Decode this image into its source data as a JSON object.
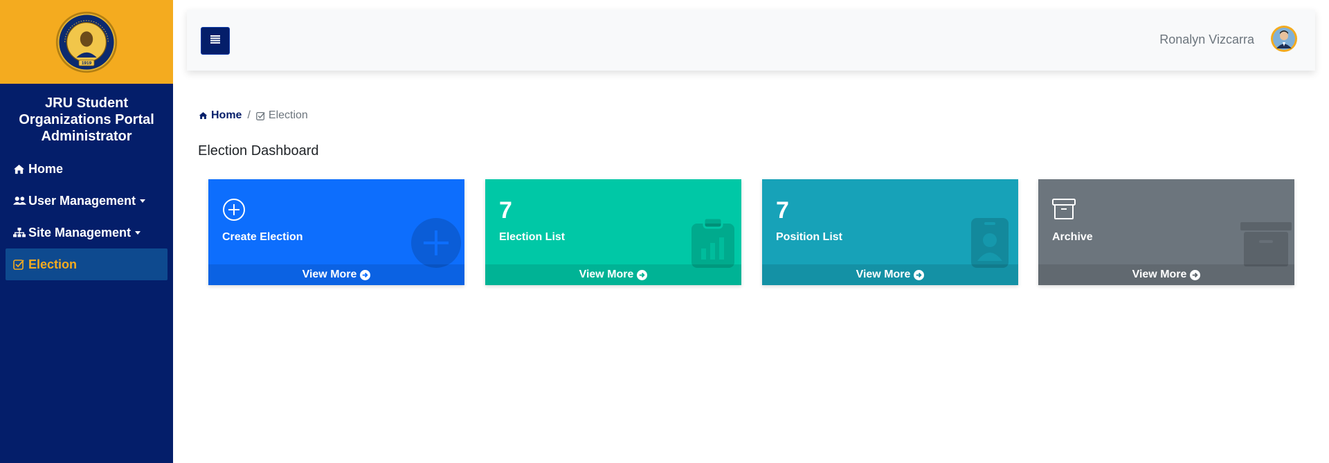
{
  "app": {
    "title": "JRU Student Organizations Portal Administrator"
  },
  "colors": {
    "sidebar": "#041e6a",
    "accent": "#f4ab1f",
    "active_item": "#0e4a8f"
  },
  "logo": {
    "text": "JOSE RIZAL UNIVERSITY",
    "year": "1919"
  },
  "sidebar": {
    "items": [
      {
        "label": "Home",
        "icon": "home-icon"
      },
      {
        "label": "User Management",
        "icon": "users-icon",
        "dropdown": true
      },
      {
        "label": "Site Management",
        "icon": "sitemap-icon",
        "dropdown": true
      },
      {
        "label": "Election",
        "icon": "check-square-icon",
        "active": true
      }
    ]
  },
  "header": {
    "user_name": "Ronalyn Vizcarra"
  },
  "breadcrumb": {
    "home": "Home",
    "current": "Election"
  },
  "page": {
    "title": "Election Dashboard"
  },
  "cards": [
    {
      "label": "Create Election",
      "value": "",
      "icon": "plus-circle-icon",
      "color": "#0d6efd",
      "footer": "View More"
    },
    {
      "label": "Election List",
      "value": "7",
      "icon": "clipboard-chart-icon",
      "color": "#00c8a6",
      "footer": "View More"
    },
    {
      "label": "Position List",
      "value": "7",
      "icon": "id-badge-icon",
      "color": "#17a2b8",
      "footer": "View More"
    },
    {
      "label": "Archive",
      "value": "",
      "icon": "archive-icon",
      "color": "#6c757d",
      "footer": "View More"
    }
  ]
}
